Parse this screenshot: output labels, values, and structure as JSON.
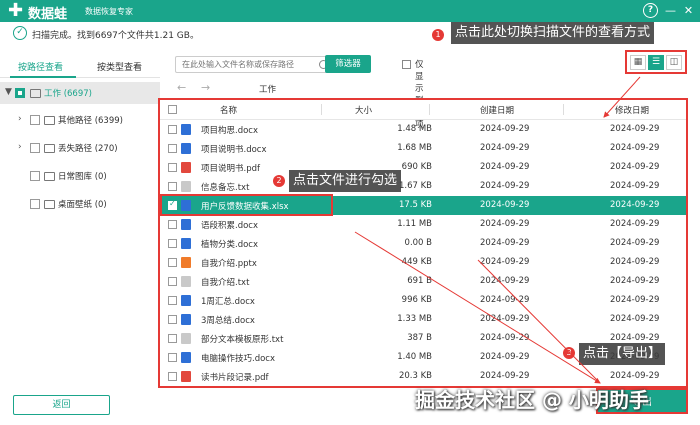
{
  "app": {
    "name": "数据蛙",
    "subtitle": "数据恢复专家"
  },
  "window": {
    "help": "?",
    "minimize": "—",
    "close": "✕"
  },
  "status": {
    "text": "扫描完成。找到6697个文件共1.21 GB。"
  },
  "tabs": [
    {
      "label": "按路径查看"
    },
    {
      "label": "按类型查看"
    }
  ],
  "tree": [
    {
      "label": "工作 (6697)",
      "arrow": "▼",
      "checked": true
    },
    {
      "label": "其他路径 (6399)",
      "arrow": "›"
    },
    {
      "label": "丢失路径 (270)",
      "arrow": "›"
    },
    {
      "label": "日常图库 (0)",
      "arrow": ""
    },
    {
      "label": "桌面壁纸 (0)",
      "arrow": ""
    }
  ],
  "back_button": "返回",
  "toolbar": {
    "search_placeholder": "在此处输入文件名称或保存路径",
    "filter_button": "筛选器",
    "only_deleted": "仅显示删除项"
  },
  "view_modes": [
    "grid-view-icon",
    "list-view-icon",
    "preview-view-icon"
  ],
  "breadcrumb": "工作",
  "table": {
    "headers": {
      "name": "名称",
      "size": "大小",
      "created": "创建日期",
      "modified": "修改日期"
    },
    "rows": [
      {
        "type": "docx",
        "name": "项目构思.docx",
        "size": "1.48 MB",
        "created": "2024-09-29",
        "modified": "2024-09-29"
      },
      {
        "type": "docx",
        "name": "项目说明书.docx",
        "size": "1.68 MB",
        "created": "2024-09-29",
        "modified": "2024-09-29"
      },
      {
        "type": "pdf",
        "name": "项目说明书.pdf",
        "size": "690 KB",
        "created": "2024-09-29",
        "modified": "2024-09-29"
      },
      {
        "type": "txt",
        "name": "信息备忘.txt",
        "size": "1.67 KB",
        "created": "2024-09-29",
        "modified": "2024-09-29"
      },
      {
        "type": "docx",
        "name": "用户反馈数据收集.xlsx",
        "size": "17.5 KB",
        "created": "2024-09-29",
        "modified": "2024-09-29",
        "selected": true
      },
      {
        "type": "docx",
        "name": "语段积累.docx",
        "size": "1.11 MB",
        "created": "2024-09-29",
        "modified": "2024-09-29"
      },
      {
        "type": "docx",
        "name": "植物分类.docx",
        "size": "0.00 B",
        "created": "2024-09-29",
        "modified": "2024-09-29"
      },
      {
        "type": "pptx",
        "name": "自我介绍.pptx",
        "size": "449 KB",
        "created": "2024-09-29",
        "modified": "2024-09-29"
      },
      {
        "type": "txt",
        "name": "自我介绍.txt",
        "size": "691 B",
        "created": "2024-09-29",
        "modified": "2024-09-29"
      },
      {
        "type": "docx",
        "name": "1周汇总.docx",
        "size": "996 KB",
        "created": "2024-09-29",
        "modified": "2024-09-29"
      },
      {
        "type": "docx",
        "name": "3周总结.docx",
        "size": "1.33 MB",
        "created": "2024-09-29",
        "modified": "2024-09-29"
      },
      {
        "type": "txt",
        "name": "部分文本模板原形.txt",
        "size": "387 B",
        "created": "2024-09-29",
        "modified": "2024-09-29"
      },
      {
        "type": "docx",
        "name": "电脑操作技巧.docx",
        "size": "1.40 MB",
        "created": "2024-09-29",
        "modified": "2024-09-29"
      },
      {
        "type": "pdf",
        "name": "读书片段记录.pdf",
        "size": "20.3 KB",
        "created": "2024-09-29",
        "modified": "2024-09-29"
      }
    ]
  },
  "annotations": [
    {
      "num": "1",
      "text": "点击此处切换扫描文件的查看方式"
    },
    {
      "num": "2",
      "text": "点击文件进行勾选"
    },
    {
      "num": "3",
      "text": "点击【导出】"
    }
  ],
  "export_button": "导出",
  "watermark": "掘金技术社区 @ 小明助手",
  "colors": {
    "accent": "#1aa58b",
    "annotation": "#e53935"
  }
}
